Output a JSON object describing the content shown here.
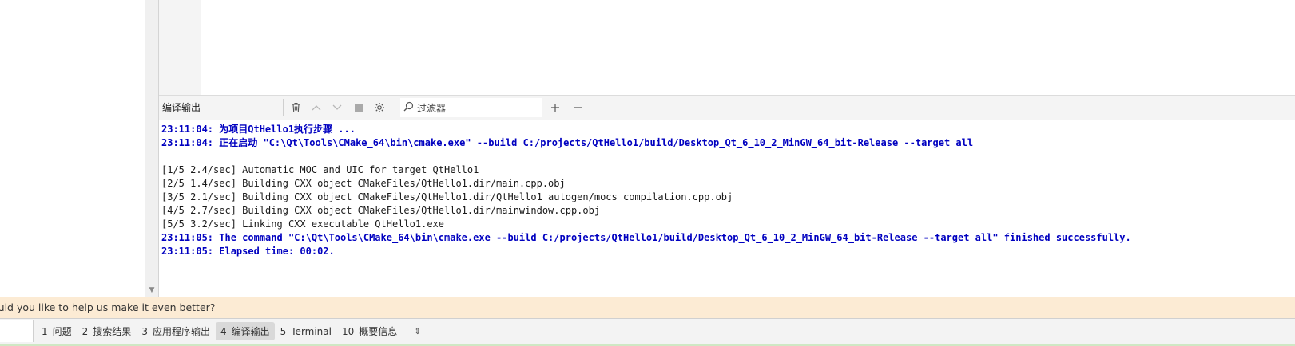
{
  "output_pane": {
    "title": "编译输出",
    "filter_placeholder": "过滤器",
    "lines": [
      {
        "text": "23:11:04: 为项目QtHello1执行步骤 ...",
        "kind": "sys"
      },
      {
        "text": "23:11:04: 正在启动 \"C:\\Qt\\Tools\\CMake_64\\bin\\cmake.exe\" --build C:/projects/QtHello1/build/Desktop_Qt_6_10_2_MinGW_64_bit-Release --target all",
        "kind": "sys"
      },
      {
        "text": "",
        "kind": "plain"
      },
      {
        "text": "[1/5 2.4/sec] Automatic MOC and UIC for target QtHello1",
        "kind": "plain"
      },
      {
        "text": "[2/5 1.4/sec] Building CXX object CMakeFiles/QtHello1.dir/main.cpp.obj",
        "kind": "plain"
      },
      {
        "text": "[3/5 2.1/sec] Building CXX object CMakeFiles/QtHello1.dir/QtHello1_autogen/mocs_compilation.cpp.obj",
        "kind": "plain"
      },
      {
        "text": "[4/5 2.7/sec] Building CXX object CMakeFiles/QtHello1.dir/mainwindow.cpp.obj",
        "kind": "plain"
      },
      {
        "text": "[5/5 3.2/sec] Linking CXX executable QtHello1.exe",
        "kind": "plain"
      },
      {
        "text": "23:11:05: The command \"C:\\Qt\\Tools\\CMake_64\\bin\\cmake.exe --build C:/projects/QtHello1/build/Desktop_Qt_6_10_2_MinGW_64_bit-Release --target all\" finished successfully.",
        "kind": "sys"
      },
      {
        "text": "23:11:05: Elapsed time: 00:02.",
        "kind": "sys"
      }
    ]
  },
  "infobar": {
    "text": "ould you like to help us make it even better?"
  },
  "bottom_tabs": [
    {
      "num": "1",
      "label": "问题",
      "active": false
    },
    {
      "num": "2",
      "label": "搜索结果",
      "active": false
    },
    {
      "num": "3",
      "label": "应用程序输出",
      "active": false
    },
    {
      "num": "4",
      "label": "编译输出",
      "active": true
    },
    {
      "num": "5",
      "label": "Terminal",
      "active": false
    },
    {
      "num": "10",
      "label": "概要信息",
      "active": false
    }
  ],
  "colors": {
    "system_message": "#0000c0",
    "infobar_bg": "#fcebd4",
    "active_tab_bg": "#d9d9d9"
  }
}
